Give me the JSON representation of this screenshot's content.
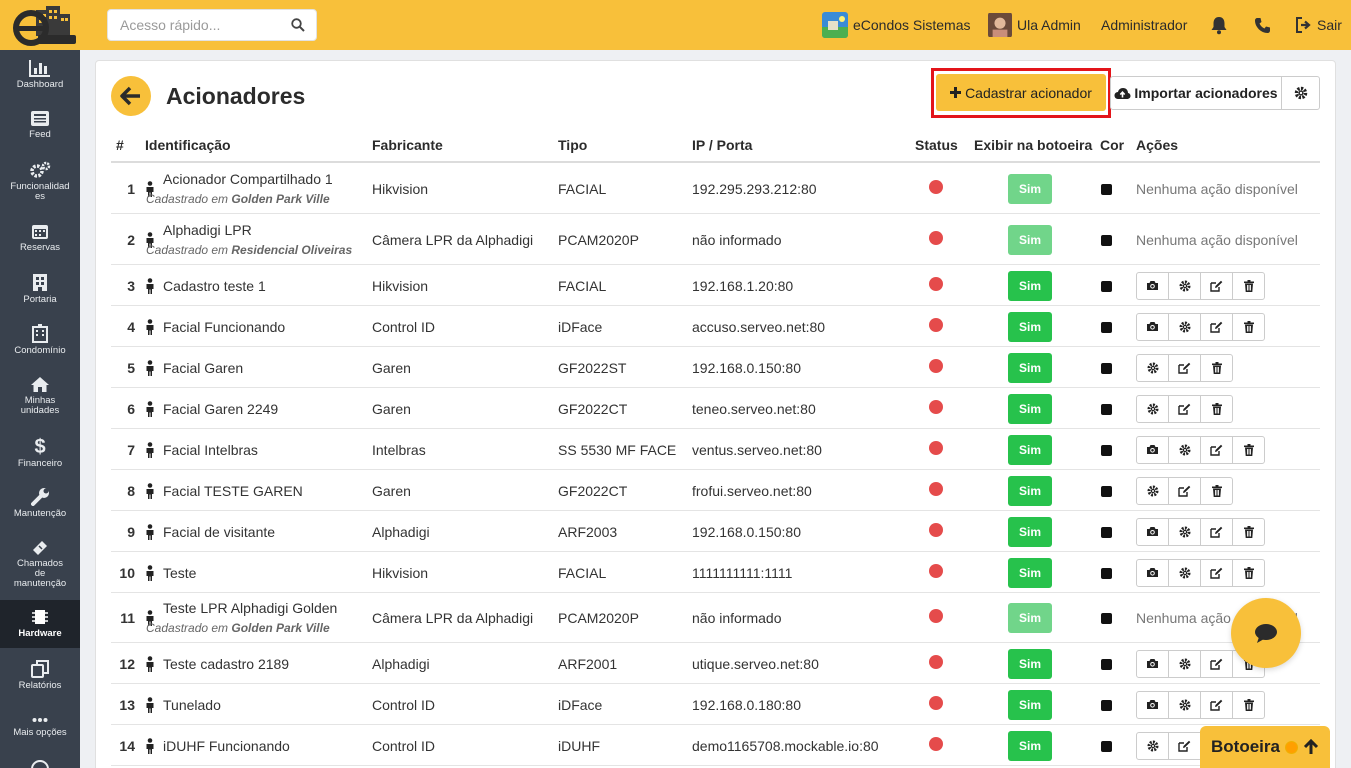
{
  "topbar": {
    "search_placeholder": "Acesso rápido...",
    "condo_name": "eCondos Sistemas",
    "user_name": "Ula Admin",
    "role": "Administrador",
    "logout_label": "Sair"
  },
  "sidebar": {
    "items": [
      {
        "label": "Dashboard",
        "icon": "bar-chart-icon"
      },
      {
        "label": "Feed",
        "icon": "newspaper-icon"
      },
      {
        "label": "Funcionalidades",
        "icon": "gears-icon"
      },
      {
        "label": "Reservas",
        "icon": "calendar-icon"
      },
      {
        "label": "Portaria",
        "icon": "building-icon"
      },
      {
        "label": "Condomínio",
        "icon": "city-icon"
      },
      {
        "label": "Minhas unidades",
        "icon": "home-icon"
      },
      {
        "label": "Financeiro",
        "icon": "dollar-icon"
      },
      {
        "label": "Manutenção",
        "icon": "wrench-icon"
      },
      {
        "label": "Chamados de manutenção",
        "icon": "ticket-icon"
      },
      {
        "label": "Hardware",
        "icon": "chip-icon"
      },
      {
        "label": "Relatórios",
        "icon": "copy-icon"
      },
      {
        "label": "Mais opções",
        "icon": "ellipsis-icon"
      }
    ],
    "active": "Hardware"
  },
  "page": {
    "title": "Acionadores",
    "add_button": "Cadastrar acionador",
    "import_button": "Importar acionadores"
  },
  "table": {
    "headers": [
      "#",
      "Identificação",
      "Fabricante",
      "Tipo",
      "IP / Porta",
      "Status",
      "Exibir na botoeira",
      "Cor",
      "Ações"
    ],
    "no_action_text": "Nenhuma ação disponível",
    "registered_prefix": "Cadastrado em",
    "rows": [
      {
        "num": "1",
        "name": "Acionador Compartilhado 1",
        "registered_in": "Golden Park Ville",
        "maker": "Hikvision",
        "type": "FACIAL",
        "ip": "192.295.293.212:80",
        "show": "Sim",
        "show_enabled": false,
        "actions": "none"
      },
      {
        "num": "2",
        "name": "Alphadigi LPR",
        "registered_in": "Residencial Oliveiras",
        "maker": "Câmera LPR da Alphadigi",
        "type": "PCAM2020P",
        "ip": "não informado",
        "show": "Sim",
        "show_enabled": false,
        "actions": "none"
      },
      {
        "num": "3",
        "name": "Cadastro teste 1",
        "maker": "Hikvision",
        "type": "FACIAL",
        "ip": "192.168.1.20:80",
        "show": "Sim",
        "show_enabled": true,
        "actions": "full"
      },
      {
        "num": "4",
        "name": "Facial Funcionando",
        "maker": "Control ID",
        "type": "iDFace",
        "ip": "accuso.serveo.net:80",
        "show": "Sim",
        "show_enabled": true,
        "actions": "full"
      },
      {
        "num": "5",
        "name": "Facial Garen",
        "maker": "Garen",
        "type": "GF2022ST",
        "ip": "192.168.0.150:80",
        "show": "Sim",
        "show_enabled": true,
        "actions": "basic"
      },
      {
        "num": "6",
        "name": "Facial Garen 2249",
        "maker": "Garen",
        "type": "GF2022CT",
        "ip": "teneo.serveo.net:80",
        "show": "Sim",
        "show_enabled": true,
        "actions": "basic"
      },
      {
        "num": "7",
        "name": "Facial Intelbras",
        "maker": "Intelbras",
        "type": "SS 5530 MF FACE",
        "ip": "ventus.serveo.net:80",
        "show": "Sim",
        "show_enabled": true,
        "actions": "full"
      },
      {
        "num": "8",
        "name": "Facial TESTE GAREN",
        "maker": "Garen",
        "type": "GF2022CT",
        "ip": "frofui.serveo.net:80",
        "show": "Sim",
        "show_enabled": true,
        "actions": "basic"
      },
      {
        "num": "9",
        "name": "Facial de visitante",
        "maker": "Alphadigi",
        "type": "ARF2003",
        "ip": "192.168.0.150:80",
        "show": "Sim",
        "show_enabled": true,
        "actions": "full"
      },
      {
        "num": "10",
        "name": "Teste",
        "maker": "Hikvision",
        "type": "FACIAL",
        "ip": "1111111111:1111",
        "show": "Sim",
        "show_enabled": true,
        "actions": "full"
      },
      {
        "num": "11",
        "name": "Teste LPR Alphadigi Golden",
        "registered_in": "Golden Park Ville",
        "maker": "Câmera LPR da Alphadigi",
        "type": "PCAM2020P",
        "ip": "não informado",
        "show": "Sim",
        "show_enabled": false,
        "actions": "none"
      },
      {
        "num": "12",
        "name": "Teste cadastro 2189",
        "maker": "Alphadigi",
        "type": "ARF2001",
        "ip": "utique.serveo.net:80",
        "show": "Sim",
        "show_enabled": true,
        "actions": "full"
      },
      {
        "num": "13",
        "name": "Tunelado",
        "maker": "Control ID",
        "type": "iDFace",
        "ip": "192.168.0.180:80",
        "show": "Sim",
        "show_enabled": true,
        "actions": "full"
      },
      {
        "num": "14",
        "name": "iDUHF Funcionando",
        "maker": "Control ID",
        "type": "iDUHF",
        "ip": "demo1165708.mockable.io:80",
        "show": "Sim",
        "show_enabled": true,
        "actions": "basic"
      }
    ]
  },
  "floating": {
    "botoeira_label": "Botoeira"
  },
  "colors": {
    "accent": "#f8c03a",
    "sidebar": "#39414d",
    "status_offline": "#e54b4b",
    "enabled_green": "#27c24c",
    "disabled_green": "#71d58a",
    "highlight": "#e3141a"
  }
}
